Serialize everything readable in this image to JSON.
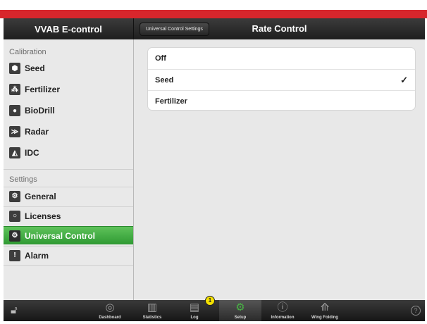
{
  "app": {
    "title": "VVAB E-control",
    "header_back": "Universal Control Settings",
    "header_title": "Rate Control",
    "accent_color": "#d8262c",
    "active_color": "#3faa3d"
  },
  "sidebar": {
    "calibration_title": "Calibration",
    "calibration_items": [
      {
        "label": "Seed",
        "icon": "seed-bag-icon"
      },
      {
        "label": "Fertilizer",
        "icon": "fertilizer-icon"
      },
      {
        "label": "BioDrill",
        "icon": "biodrill-icon"
      },
      {
        "label": "Radar",
        "icon": "radar-icon"
      },
      {
        "label": "IDC",
        "icon": "idc-icon"
      }
    ],
    "settings_title": "Settings",
    "settings_items": [
      {
        "label": "General",
        "icon": "gears-icon"
      },
      {
        "label": "Licenses",
        "icon": "license-icon"
      },
      {
        "label": "Universal Control",
        "icon": "gears-icon",
        "active": true
      },
      {
        "label": "Alarm",
        "icon": "alarm-icon"
      }
    ]
  },
  "rate_control": {
    "options": [
      {
        "label": "Off",
        "selected": false
      },
      {
        "label": "Seed",
        "selected": true
      },
      {
        "label": "Fertilizer",
        "selected": false
      }
    ],
    "check": "✓"
  },
  "tabbar": {
    "tabs": [
      {
        "label": "Dashboard",
        "icon": "gauge-icon"
      },
      {
        "label": "Statistics",
        "icon": "bar-chart-icon"
      },
      {
        "label": "Log",
        "icon": "log-icon"
      },
      {
        "label": "Setup",
        "icon": "gears-icon",
        "active": true
      },
      {
        "label": "Information",
        "icon": "info-icon"
      },
      {
        "label": "Wing Folding",
        "icon": "wing-folding-icon"
      }
    ],
    "log_badge": "1",
    "help": "?"
  }
}
